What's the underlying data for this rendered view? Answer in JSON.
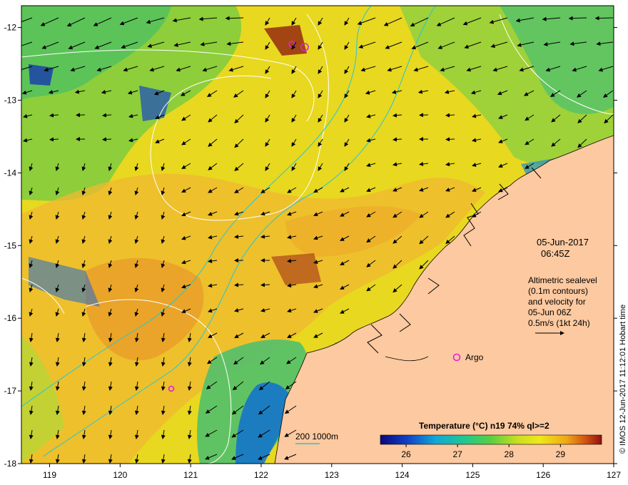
{
  "map": {
    "lon_range": [
      118.6,
      127
    ],
    "lat_range": [
      -18,
      -11.7
    ],
    "lon_ticks": [
      "119",
      "120",
      "121",
      "122",
      "123",
      "124",
      "125",
      "126",
      "127"
    ],
    "lat_ticks": [
      "-12",
      "-13",
      "-14",
      "-15",
      "-16",
      "-17",
      "-18"
    ],
    "colors": {
      "land": "#fdc9a0",
      "sst_warm": "#e8a020",
      "sst_mid": "#e8e020",
      "sst_cool": "#58c850",
      "sst_cold": "#1848c0",
      "contour": "#ffffff",
      "isobath": "#20c8d8",
      "argo": "#e020e0"
    }
  },
  "annotations": {
    "date": "05-Jun-2017",
    "time": "06:45Z",
    "altimetry_line1": "Altimetric sealevel",
    "altimetry_line2": "(0.1m contours)",
    "altimetry_line3": "and velocity for",
    "altimetry_line4": "05-Jun 06Z",
    "velocity_scale": "0.5m/s (1kt 24h)",
    "argo_label": "Argo",
    "isobath_legend": "200  1000m"
  },
  "colorbar": {
    "title": "Temperature (°C) n19 74% ql>=2",
    "ticks": [
      "26",
      "27",
      "28",
      "29"
    ],
    "range": [
      25.5,
      29.8
    ]
  },
  "credit": "© IMOS 12-Jun-2017 11:12:01 Hobart time"
}
